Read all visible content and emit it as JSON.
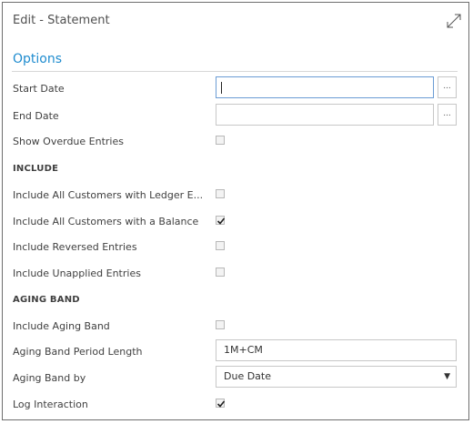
{
  "dialog": {
    "title": "Edit - Statement",
    "expand_icon": "expand-diagonal-icon"
  },
  "options": {
    "section_title": "Options",
    "start_date": {
      "label": "Start Date",
      "value": "",
      "lookup_label": "..."
    },
    "end_date": {
      "label": "End Date",
      "value": "",
      "lookup_label": "..."
    },
    "show_overdue": {
      "label": "Show Overdue Entries",
      "checked": false
    }
  },
  "include": {
    "heading": "INCLUDE",
    "all_customers_ledger": {
      "label": "Include All Customers with Ledger E...",
      "checked": false
    },
    "all_customers_balance": {
      "label": "Include All Customers with a Balance",
      "checked": true
    },
    "reversed_entries": {
      "label": "Include Reversed Entries",
      "checked": false
    },
    "unapplied_entries": {
      "label": "Include Unapplied Entries",
      "checked": false
    }
  },
  "aging_band": {
    "heading": "AGING BAND",
    "include_aging_band": {
      "label": "Include Aging Band",
      "checked": false
    },
    "period_length": {
      "label": "Aging Band Period Length",
      "value": "1M+CM"
    },
    "aging_band_by": {
      "label": "Aging Band by",
      "value": "Due Date"
    },
    "log_interaction": {
      "label": "Log Interaction",
      "checked": true
    }
  },
  "colors": {
    "accent": "#1f8ccf",
    "focus_border": "#6b9cd4",
    "border": "#c7c7c7"
  }
}
